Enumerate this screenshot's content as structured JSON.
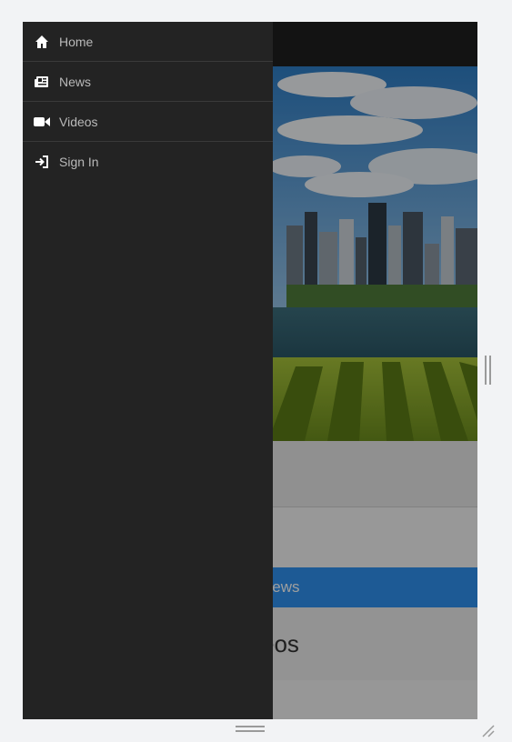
{
  "drawer": {
    "items": [
      {
        "label": "Home",
        "icon": "home-icon"
      },
      {
        "label": "News",
        "icon": "newspaper-icon"
      },
      {
        "label": "Videos",
        "icon": "video-icon"
      },
      {
        "label": "Sign In",
        "icon": "sign-in-icon"
      }
    ]
  },
  "main": {
    "news_bar_label": "News",
    "videos_heading": "eos"
  },
  "colors": {
    "drawer_bg": "#232323",
    "accent": "#2f92f0",
    "topbar_bg": "#1f1f1f"
  }
}
